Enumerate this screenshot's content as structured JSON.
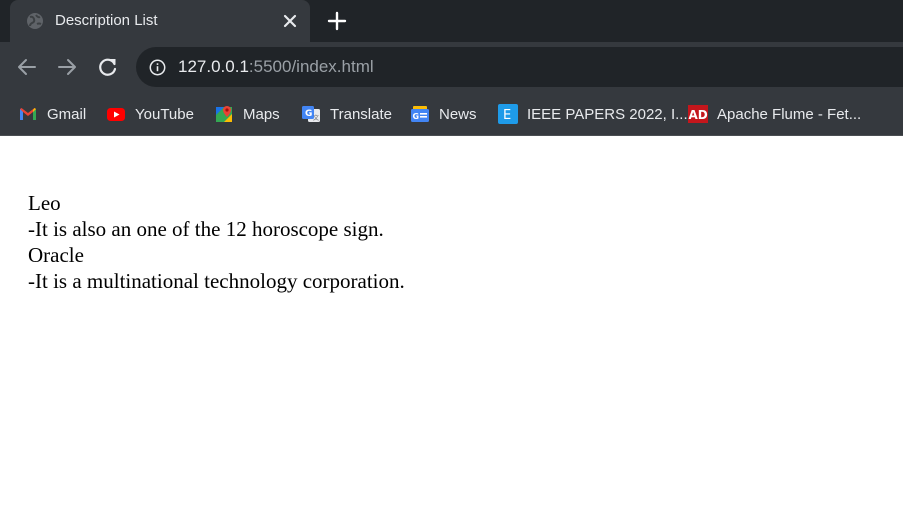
{
  "browser": {
    "tab": {
      "title": "Description List",
      "close_symbol": "✕",
      "favicon": "globe-icon"
    },
    "new_tab_symbol": "+",
    "toolbar": {
      "back_icon": "arrow-left-icon",
      "forward_icon": "arrow-right-icon",
      "reload_icon": "reload-icon",
      "url_host": "127.0.0.1",
      "url_path": ":5500/index.html",
      "site_info_icon": "info-icon"
    },
    "bookmarks": [
      {
        "label": "Gmail",
        "icon": "gmail-icon"
      },
      {
        "label": "YouTube",
        "icon": "youtube-icon"
      },
      {
        "label": "Maps",
        "icon": "maps-icon"
      },
      {
        "label": "Translate",
        "icon": "translate-icon"
      },
      {
        "label": "News",
        "icon": "news-icon"
      },
      {
        "label": "IEEE PAPERS 2022, I...",
        "icon": "ieee-e-icon"
      },
      {
        "label": "Apache Flume - Fet...",
        "icon": "apache-ad-icon"
      }
    ],
    "colors": {
      "tabstrip": "#202428",
      "toolbar": "#35393e",
      "omnibox": "#202428",
      "text": "#e8eaed",
      "muted_text": "#9aa0a6"
    }
  },
  "page": {
    "description_list": [
      {
        "term": "Leo",
        "definition": "-It is also an one of the 12 horoscope sign."
      },
      {
        "term": "Oracle",
        "definition": "-It is a multinational technology corporation."
      }
    ]
  }
}
